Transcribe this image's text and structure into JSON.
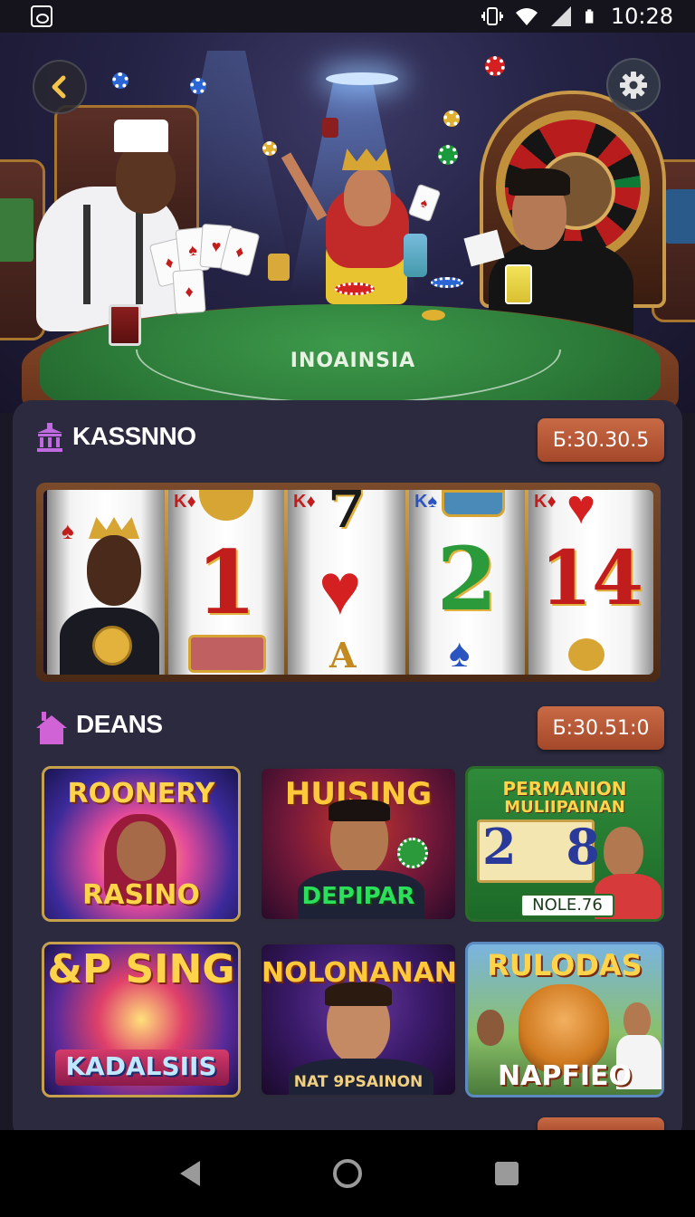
{
  "status_bar": {
    "time": "10:28",
    "icons": [
      "gallery-icon",
      "vibrate-icon",
      "wifi-icon",
      "signal-icon",
      "battery-icon"
    ]
  },
  "hero": {
    "table_text": "INOAINSIA",
    "back_icon": "chevron-left-icon",
    "settings_icon": "gear-icon"
  },
  "section1": {
    "icon": "casino-building-icon",
    "title": "KASSNNO",
    "balance": "Б:30.30.5",
    "reels": [
      "K",
      "1",
      "7",
      "2",
      "14"
    ]
  },
  "section2": {
    "icon": "house-icon",
    "title": "DEANS",
    "balance": "Б:30.51:0",
    "games": [
      {
        "title": "ROONERY",
        "subtitle": "RASINO"
      },
      {
        "title": "HUISING",
        "subtitle": "DEPIPAR"
      },
      {
        "title": "PERMANION",
        "subtitle": "MULIIPAINAN",
        "badge": "NOLE.76",
        "digits": "2 8"
      },
      {
        "title": "&P SING",
        "subtitle": "KADALSIIS"
      },
      {
        "title": "NOLONANAN",
        "subtitle": "NAT 9PSAINON"
      },
      {
        "title": "RULODAS",
        "subtitle": "NAPFIEO"
      }
    ]
  },
  "colors": {
    "panel": "#2b2a3f",
    "pill": "#b65533",
    "gold": "#d9ad5e",
    "felt": "#2c7a38"
  },
  "nav": {
    "back": "triangle-back-icon",
    "home": "circle-home-icon",
    "recents": "square-recents-icon"
  }
}
